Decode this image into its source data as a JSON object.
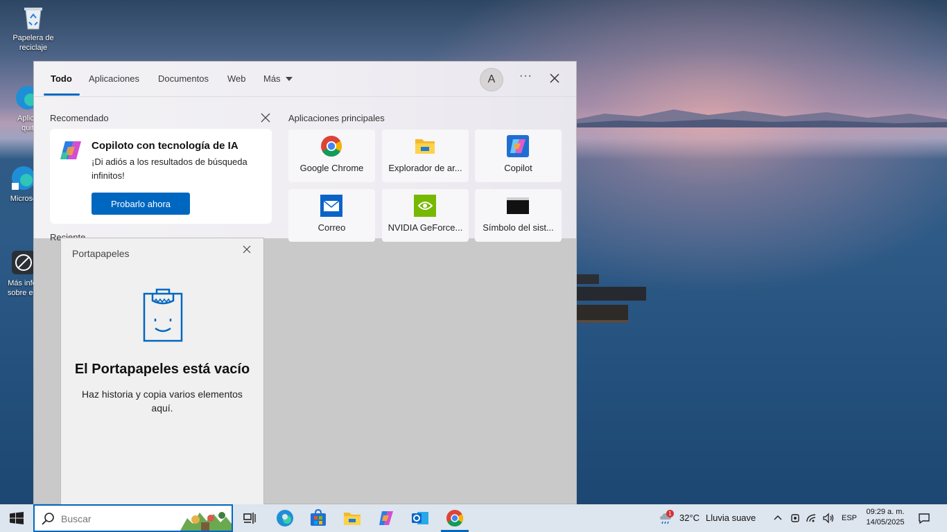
{
  "desktop": {
    "icons": [
      {
        "label": "Papelera de reciclaje"
      },
      {
        "label": "Aplicaciones quitadas"
      },
      {
        "label": "Microsoft Edge"
      },
      {
        "label": "Más información sobre esta imagen"
      }
    ],
    "icon_visible_labels": [
      "Papelera de\nreciclaje",
      "Aplica\nquit",
      "Microso",
      "Más info\nsobre es"
    ]
  },
  "search": {
    "tabs": [
      {
        "label": "Todo",
        "active": true
      },
      {
        "label": "Aplicaciones"
      },
      {
        "label": "Documentos"
      },
      {
        "label": "Web"
      },
      {
        "label": "Más"
      }
    ],
    "avatar_letter": "A",
    "more_label": "···",
    "recommended": {
      "title": "Recomendado",
      "card_title": "Copiloto con tecnología de IA",
      "card_desc": "¡Di adiós a los resultados de búsqueda infinitos!",
      "button": "Probarlo ahora"
    },
    "recent_title": "Reciente",
    "top_apps": {
      "title": "Aplicaciones principales",
      "apps": [
        {
          "label": "Google Chrome",
          "icon": "chrome-icon"
        },
        {
          "label": "Explorador de ar...",
          "icon": "folder-icon"
        },
        {
          "label": "Copilot",
          "icon": "copilot-icon"
        },
        {
          "label": "Correo",
          "icon": "mail-icon"
        },
        {
          "label": "NVIDIA GeForce...",
          "icon": "nvidia-icon"
        },
        {
          "label": "Símbolo del sist...",
          "icon": "terminal-icon"
        }
      ]
    }
  },
  "clipboard": {
    "title": "Portapapeles",
    "heading": "El Portapapeles está vacío",
    "subtitle": "Haz historia y copia varios elementos aquí."
  },
  "taskbar": {
    "search_placeholder": "Buscar",
    "weather": {
      "temp": "32°C",
      "desc": "Lluvia suave",
      "alert_count": "1"
    },
    "language": "ESP",
    "time": "09:29 a. m.",
    "date": "14/05/2025",
    "accent": "#0067c0"
  }
}
